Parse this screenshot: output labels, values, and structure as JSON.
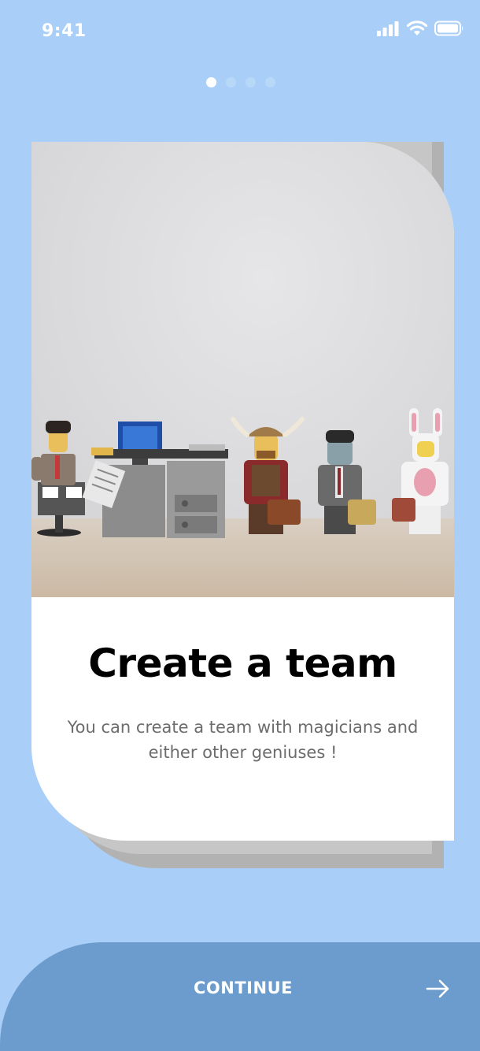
{
  "status_bar": {
    "time": "9:41",
    "icons": [
      "signal-icon",
      "wifi-icon",
      "battery-icon"
    ]
  },
  "pager": {
    "total": 4,
    "active_index": 0
  },
  "card": {
    "image_description_icon": "lego-team-photo",
    "title": "Create a team",
    "description": "You can create a team with magicians and either other geniuses !"
  },
  "continue": {
    "label": "CONTINUE",
    "icon": "arrow-right-icon"
  },
  "colors": {
    "background": "#a9cff8",
    "button": "#6c9ccd",
    "card": "#ffffff",
    "title": "#000000",
    "text": "#6c6c6c"
  }
}
